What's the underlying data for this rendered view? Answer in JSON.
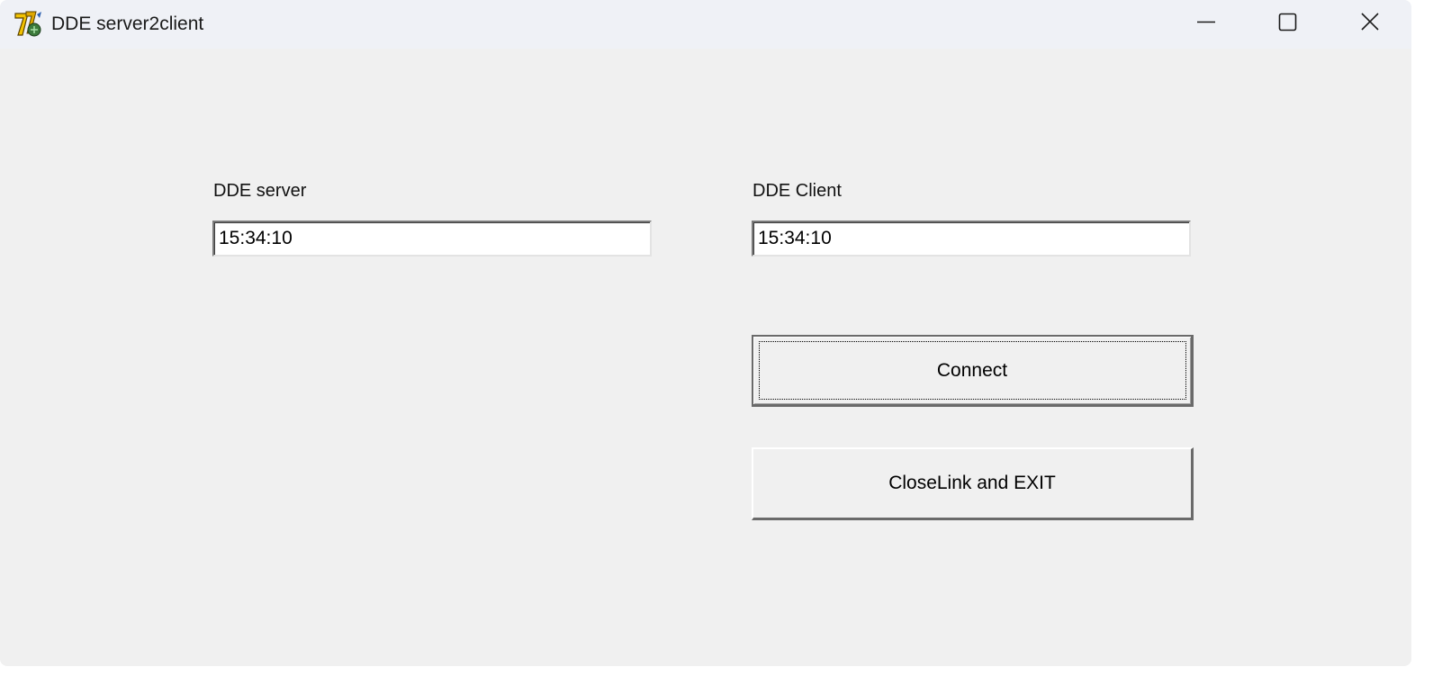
{
  "window": {
    "title": "DDE server2client",
    "icon": "app-icon",
    "controls": {
      "minimize_icon": "minimize-icon",
      "maximize_icon": "maximize-icon",
      "close_icon": "close-icon"
    }
  },
  "server": {
    "label": "DDE server",
    "value": "15:34:10"
  },
  "client": {
    "label": "DDE Client",
    "value": "15:34:10"
  },
  "buttons": {
    "connect": "Connect",
    "close_exit": "CloseLink and EXIT"
  },
  "colors": {
    "titlebar": "#eff1f6",
    "window_bg": "#f0f0f0"
  }
}
